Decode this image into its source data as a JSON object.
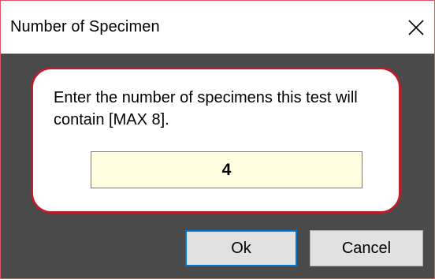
{
  "window": {
    "title": "Number of Specimen",
    "close_icon": "close-icon"
  },
  "dialog": {
    "prompt": "Enter the number of specimens this test will contain [MAX 8].",
    "input_value": "4"
  },
  "buttons": {
    "ok_label": "Ok",
    "cancel_label": "Cancel"
  },
  "colors": {
    "window_border": "#e0556a",
    "background": "#4a4a4a",
    "panel_border": "#b81f2a",
    "input_background": "#fefee0",
    "default_button_border": "#0078d7",
    "button_face": "#e1e1e1"
  }
}
